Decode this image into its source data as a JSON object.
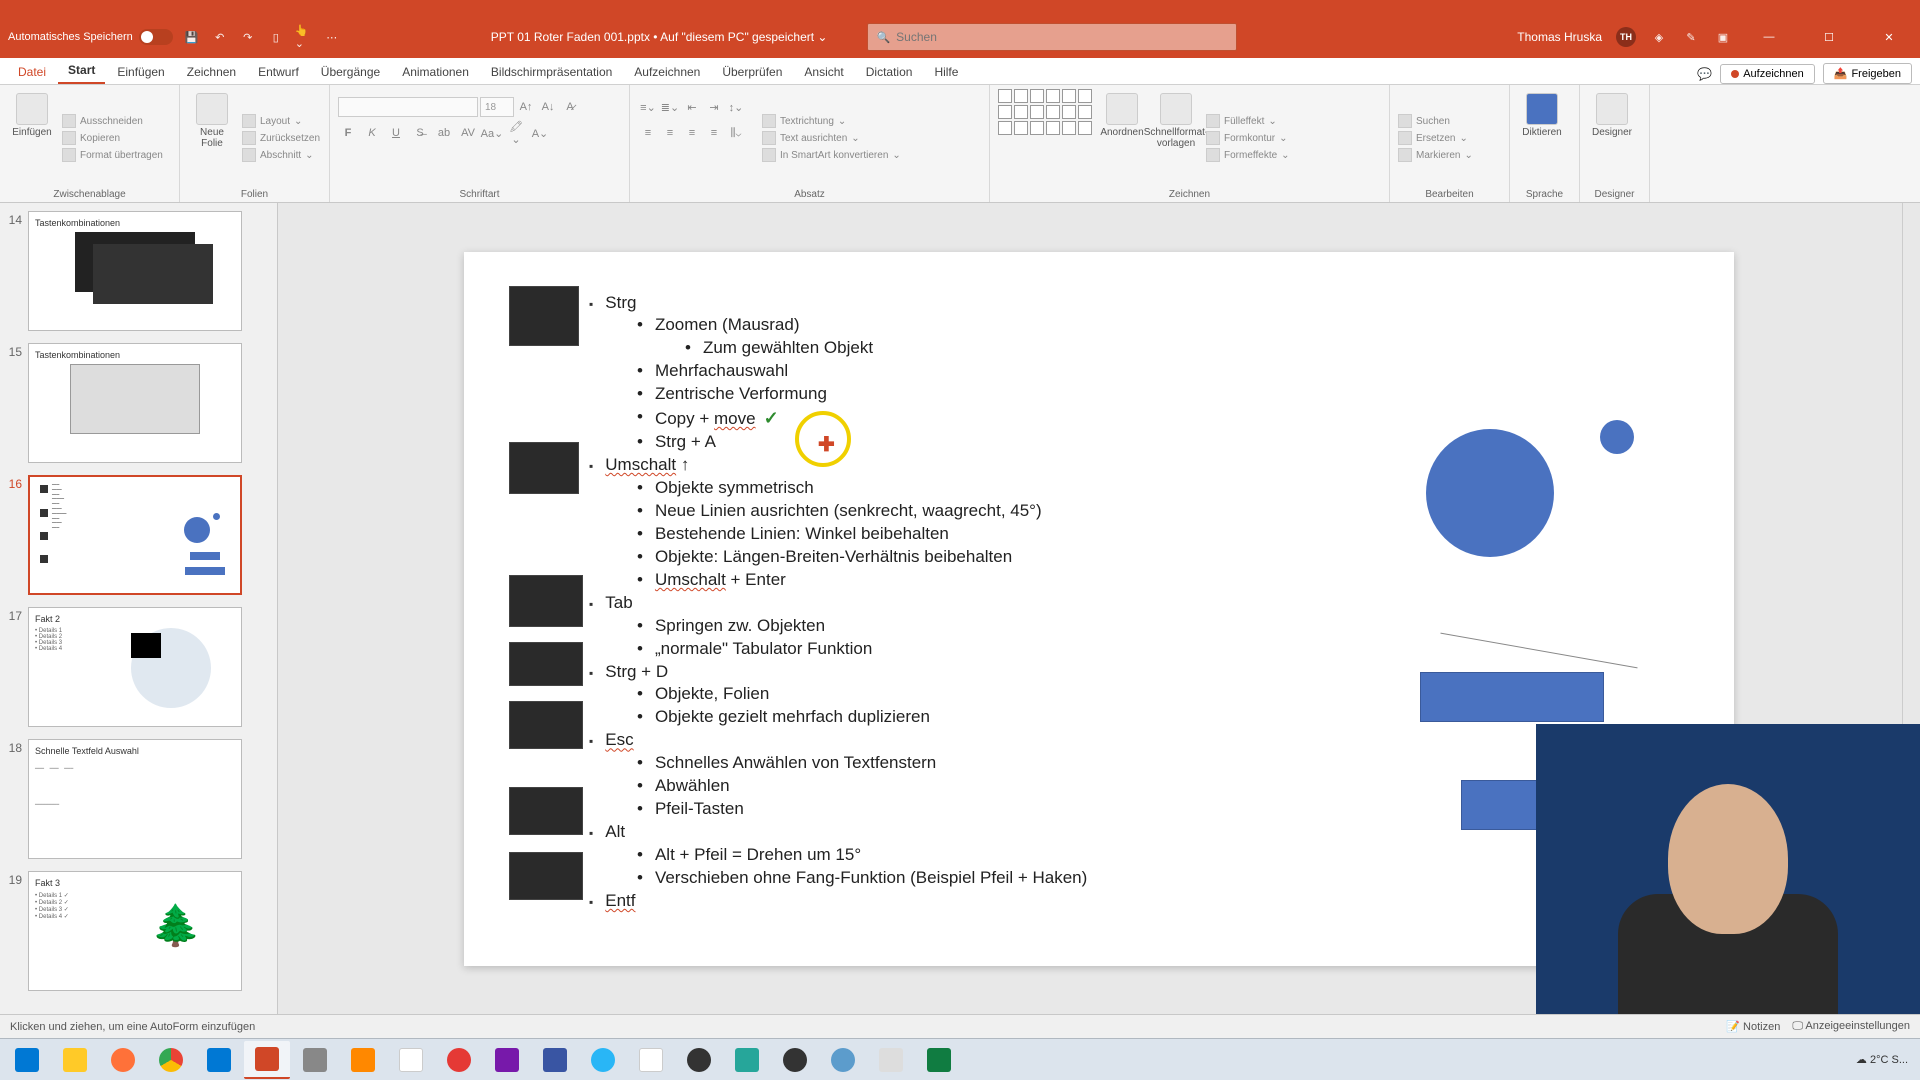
{
  "qat": {
    "autosave_label": "Automatisches Speichern",
    "doc_title": "PPT 01 Roter Faden 001.pptx • Auf \"diesem PC\" gespeichert ⌄",
    "search_placeholder": "Suchen",
    "user_name": "Thomas Hruska",
    "user_initials": "TH"
  },
  "tabs": {
    "file": "Datei",
    "home": "Start",
    "insert": "Einfügen",
    "draw": "Zeichnen",
    "design": "Entwurf",
    "transitions": "Übergänge",
    "animations": "Animationen",
    "slideshow": "Bildschirmpräsentation",
    "record": "Aufzeichnen",
    "review": "Überprüfen",
    "view": "Ansicht",
    "dictation": "Dictation",
    "help": "Hilfe",
    "record_btn": "Aufzeichnen",
    "share_btn": "Freigeben"
  },
  "ribbon": {
    "clipboard": {
      "label": "Zwischenablage",
      "paste": "Einfügen",
      "cut": "Ausschneiden",
      "copy": "Kopieren",
      "format": "Format übertragen"
    },
    "slides": {
      "label": "Folien",
      "new": "Neue\nFolie",
      "layout": "Layout",
      "reset": "Zurücksetzen",
      "section": "Abschnitt"
    },
    "font": {
      "label": "Schriftart",
      "size": "18"
    },
    "paragraph": {
      "label": "Absatz",
      "textdir": "Textrichtung",
      "align": "Text ausrichten",
      "smartart": "In SmartArt konvertieren"
    },
    "drawing": {
      "label": "Zeichnen",
      "arrange": "Anordnen",
      "quickstyles": "Schnellformat-\nvorlagen",
      "fill": "Fülleffekt",
      "outline": "Formkontur",
      "effects": "Formeffekte"
    },
    "editing": {
      "label": "Bearbeiten",
      "find": "Suchen",
      "replace": "Ersetzen",
      "select": "Markieren"
    },
    "voice": {
      "label": "Sprache",
      "dictate": "Diktieren"
    },
    "designer": {
      "label": "Designer",
      "btn": "Designer"
    }
  },
  "thumbs": {
    "s14": {
      "num": "14",
      "title": "Tastenkombinationen"
    },
    "s15": {
      "num": "15",
      "title": "Tastenkombinationen"
    },
    "s16": {
      "num": "16",
      "title": ""
    },
    "s17": {
      "num": "17",
      "title": "Fakt 2",
      "details": "• Details 1\n• Details 2\n• Details 3\n• Details 4"
    },
    "s18": {
      "num": "18",
      "title": "Schnelle Textfeld Auswahl"
    },
    "s19": {
      "num": "19",
      "title": "Fakt 3",
      "details": "• Details 1 ✓\n• Details 2 ✓\n• Details 3 ✓\n• Details 4 ✓"
    }
  },
  "slide": {
    "strg": "Strg",
    "zoom": "Zoomen (Mausrad)",
    "zum": "Zum gewählten Objekt",
    "mehrfach": "Mehrfachauswahl",
    "zentrisch": "Zentrische Verformung",
    "copy": "Copy + ",
    "move": "move",
    "strga": "Strg + A",
    "umschalt": "Umschalt",
    "arrow": " ↑",
    "sym": "Objekte symmetrisch",
    "neue": "Neue Linien ausrichten (senkrecht, waagrecht, 45°)",
    "bestehende": "Bestehende Linien: Winkel beibehalten",
    "obj_ratio": "Objekte: Längen-Breiten-Verhältnis beibehalten",
    "umenter_a": "Umschalt",
    "umenter_b": " + Enter",
    "tab": "Tab",
    "springen": "Springen zw. Objekten",
    "normale": "„normale\" Tabulator Funktion",
    "strgd": "Strg + D",
    "objfolien": "Objekte, Folien",
    "gezielt": "Objekte gezielt mehrfach duplizieren",
    "esc": "Esc",
    "schnelles": "Schnelles Anwählen von Textfenstern",
    "abwaehlen": "Abwählen",
    "pfeil": "Pfeil-Tasten",
    "alt": "Alt",
    "altpfeil": "Alt + Pfeil = Drehen um 15°",
    "verschieben": "Verschieben ohne Fang-Funktion (Beispiel Pfeil + Haken)",
    "entf": "Entf"
  },
  "status": {
    "hint": "Klicken und ziehen, um eine AutoForm einzufügen",
    "notes": "Notizen",
    "display": "Anzeigeeinstellungen"
  },
  "taskbar": {
    "weather": "☁ 2°C  S..."
  }
}
